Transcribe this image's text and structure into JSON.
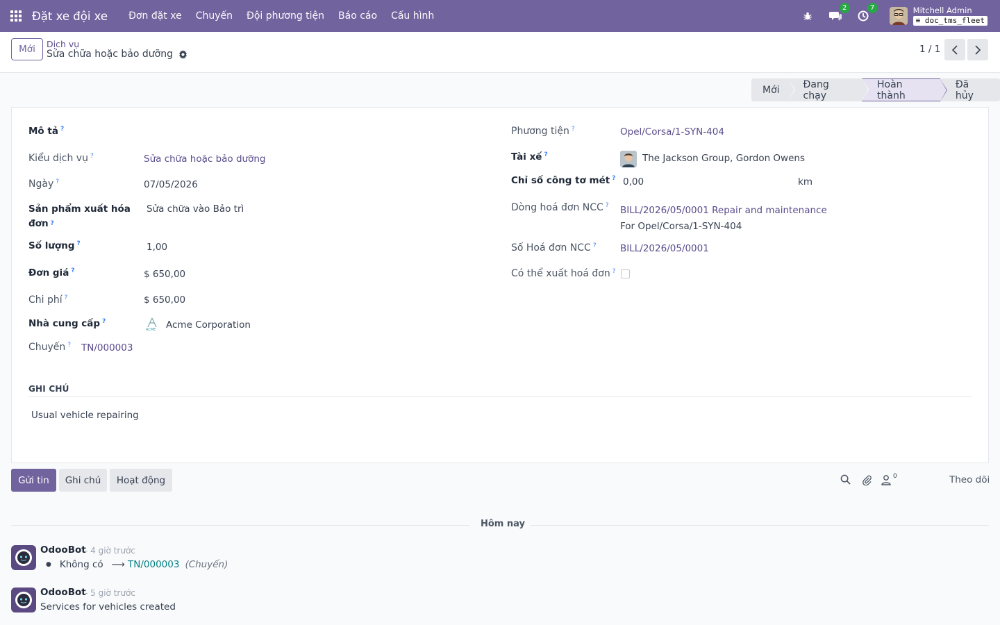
{
  "navbar": {
    "app_title": "Đặt xe đội xe",
    "menu": [
      "Đơn đặt xe",
      "Chuyến",
      "Đội phương tiện",
      "Báo cáo",
      "Cấu hình"
    ],
    "messages_badge": "2",
    "activities_badge": "7",
    "user_name": "Mitchell Admin",
    "db_name": "doc_tms_fleet"
  },
  "control": {
    "new_button": "Mới",
    "breadcrumb_parent": "Dịch vụ",
    "breadcrumb_current": "Sửa chữa hoặc bảo dưỡng",
    "pager": "1 / 1"
  },
  "statusbar": {
    "stages": [
      "Mới",
      "Đang chạy",
      "Hoàn thành",
      "Đã hủy"
    ],
    "active": "Hoàn thành"
  },
  "form": {
    "help_mark": "?",
    "left": {
      "description_label": "Mô tả",
      "service_type_label": "Kiểu dịch vụ",
      "service_type_value": "Sửa chữa hoặc bảo dưỡng",
      "date_label": "Ngày",
      "date_value": "07/05/2026",
      "product_label_line1": "Sản phẩm xuất hóa",
      "product_label_line2": "đơn",
      "product_value": "Sửa chữa vào Bảo trì",
      "quantity_label": "Số lượng",
      "quantity_value": "1,00",
      "unit_price_label": "Đơn giá",
      "unit_price_value": "$ 650,00",
      "cost_label": "Chi phí",
      "cost_value": "$ 650,00",
      "vendor_label": "Nhà cung cấp",
      "vendor_value": "Acme Corporation",
      "vendor_logo_text": "ACME",
      "trip_label": "Chuyến",
      "trip_value": "TN/000003"
    },
    "right": {
      "vehicle_label": "Phương tiện",
      "vehicle_value": "Opel/Corsa/1-SYN-404",
      "driver_label": "Tài xế",
      "driver_value": "The Jackson Group, Gordon Owens",
      "odometer_label": "Chỉ số công tơ mét",
      "odometer_value": "0,00",
      "odometer_unit": "km",
      "bill_line_label": "Dòng hoá đơn NCC",
      "bill_line_value_line1": "BILL/2026/05/0001 Repair and maintenance",
      "bill_line_value_line2": "For Opel/Corsa/1-SYN-404",
      "bill_number_label": "Số Hoá đơn NCC",
      "bill_number_value": "BILL/2026/05/0001",
      "invoiceable_label": "Có thể xuất hoá đơn",
      "invoiceable_checked": false
    },
    "notes_title": "GHI CHÚ",
    "notes_value": "Usual vehicle repairing"
  },
  "chatter": {
    "send_message": "Gửi tin",
    "log_note": "Ghi chú",
    "activities": "Hoạt động",
    "followers_count": "0",
    "follow": "Theo dõi",
    "day_separator": "Hôm nay",
    "messages": [
      {
        "author": "OdooBot",
        "time": "- 4 giờ trước",
        "tracking_old": "Không có",
        "tracking_new": "TN/000003",
        "tracking_field": "(Chuyến)"
      },
      {
        "author": "OdooBot",
        "time": "- 5 giờ trước",
        "body": "Services for vehicles created"
      }
    ]
  }
}
